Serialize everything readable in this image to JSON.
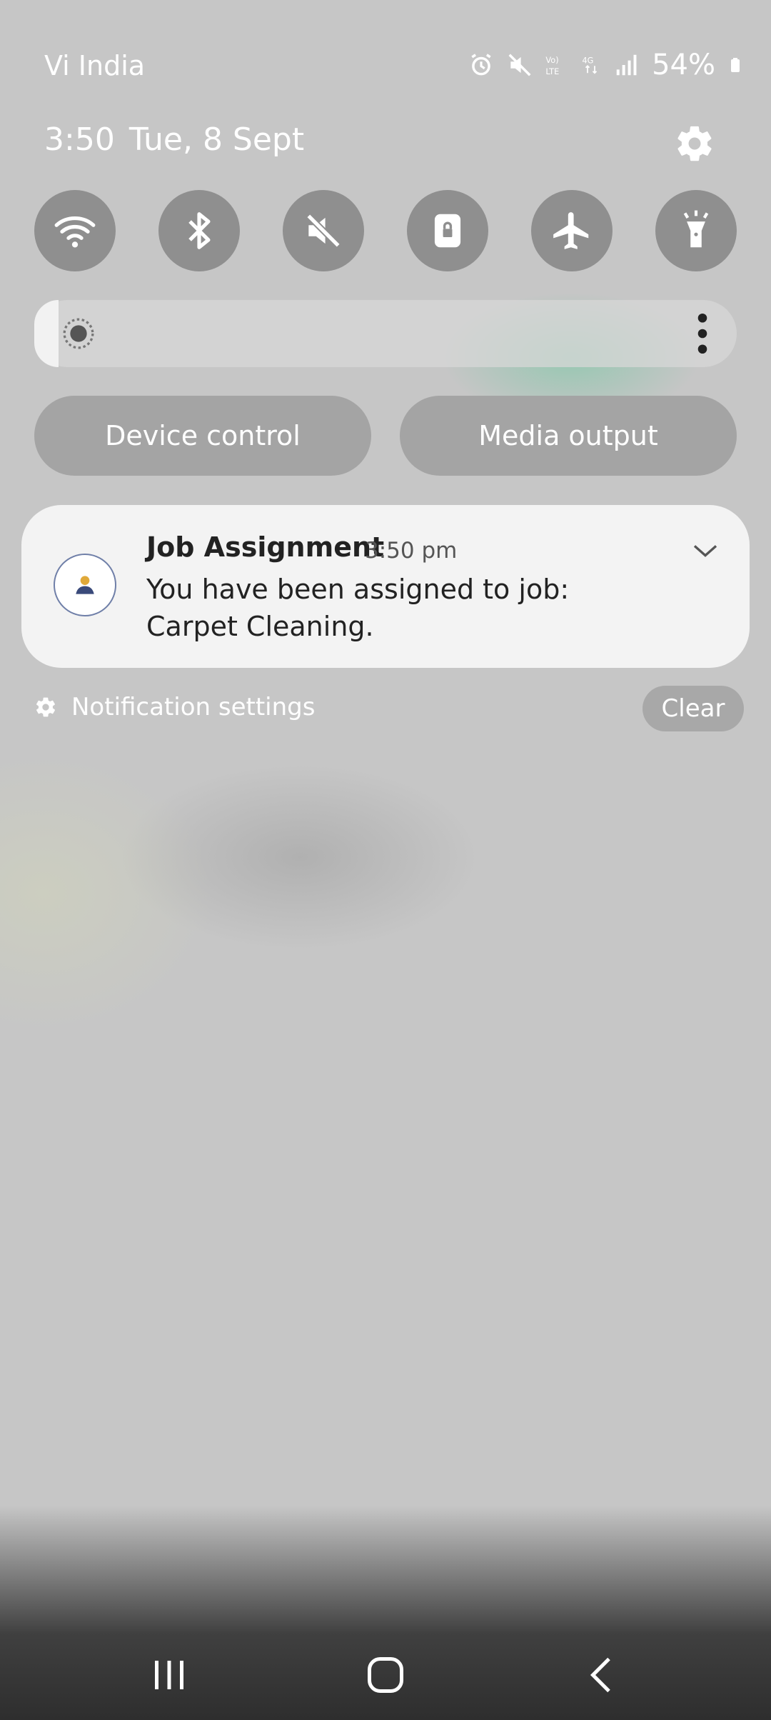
{
  "status_bar": {
    "carrier": "Vi India",
    "network_label": "Vo) LTE",
    "network_type": "4G",
    "battery_percent": "54%"
  },
  "header": {
    "time": "3:50",
    "date": "Tue, 8 Sept"
  },
  "quick_toggles": [
    {
      "name": "wifi",
      "icon": "wifi-icon"
    },
    {
      "name": "bluetooth",
      "icon": "bluetooth-icon"
    },
    {
      "name": "sound",
      "icon": "mute-icon"
    },
    {
      "name": "rotation-lock",
      "icon": "lock-icon"
    },
    {
      "name": "airplane-mode",
      "icon": "airplane-icon"
    },
    {
      "name": "flashlight",
      "icon": "flashlight-icon"
    }
  ],
  "brightness": {
    "level_fraction": 0.03
  },
  "buttons": {
    "device_control": "Device control",
    "media_output": "Media output"
  },
  "notification": {
    "title": "Job Assignment",
    "time": "3:50 pm",
    "body": "You have been assigned to job: Carpet Cleaning."
  },
  "footer": {
    "notification_settings": "Notification settings",
    "clear": "Clear"
  },
  "colors": {
    "background": "#c6c6c6",
    "toggle": "#8f8f8f",
    "card": "#f3f3f3",
    "accent_glow": "#6ec8a0"
  }
}
